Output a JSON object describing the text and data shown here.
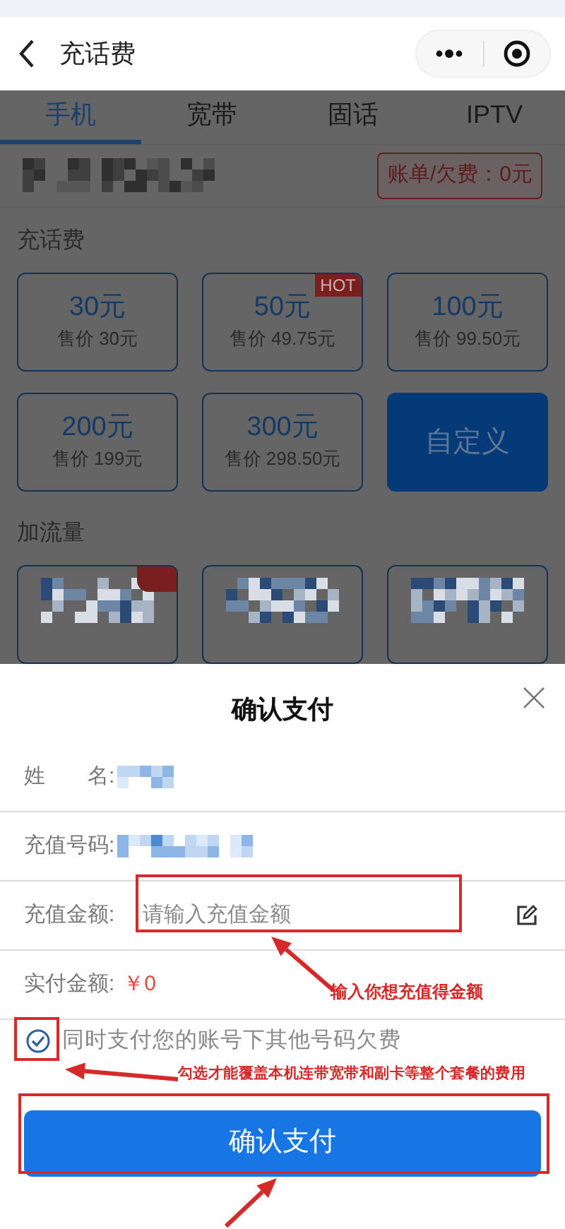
{
  "nav": {
    "title": "充话费"
  },
  "tabs": [
    {
      "label": "手机",
      "selected": true
    },
    {
      "label": "宽带",
      "selected": false
    },
    {
      "label": "固话",
      "selected": false
    },
    {
      "label": "IPTV",
      "selected": false
    }
  ],
  "account": {
    "bill_badge": "账单/欠费：0元"
  },
  "recharge": {
    "title": "充话费",
    "options": [
      {
        "kind": "amount",
        "amount": "30元",
        "price": "售价 30元",
        "selected": false
      },
      {
        "kind": "amount",
        "amount": "50元",
        "price": "售价 49.75元",
        "badge": "HOT",
        "selected": false
      },
      {
        "kind": "amount",
        "amount": "100元",
        "price": "售价 99.50元",
        "selected": false
      },
      {
        "kind": "amount",
        "amount": "200元",
        "price": "售价 199元",
        "selected": false
      },
      {
        "kind": "amount",
        "amount": "300元",
        "price": "售价 298.50元",
        "selected": false
      },
      {
        "kind": "custom",
        "amount": "自定义",
        "selected": true
      }
    ]
  },
  "data_plans": {
    "title": "加流量"
  },
  "sheet": {
    "title": "确认支付",
    "rows": [
      {
        "kind": "redacted",
        "label": "姓　　名:"
      },
      {
        "kind": "redacted",
        "label": "充值号码:"
      },
      {
        "kind": "input",
        "label": "充值金额:",
        "placeholder": "请输入充值金额"
      },
      {
        "kind": "amount",
        "label": "实付金额:",
        "value": "￥0"
      }
    ],
    "checkbox": {
      "label": "同时支付您的账号下其他号码欠费",
      "checked": true
    },
    "button": "确认支付"
  },
  "annotations": [
    {
      "text": "输入你想充值得金额"
    },
    {
      "text": "勾选才能覆盖本机连带宽带和副卡等整个套餐的费用"
    }
  ]
}
